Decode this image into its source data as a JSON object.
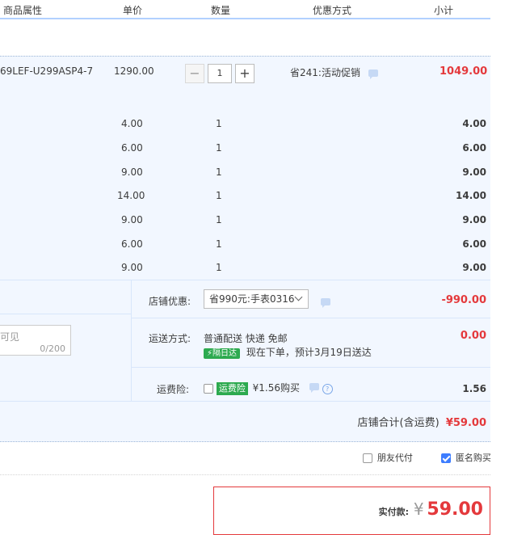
{
  "header": {
    "col_attr": "商品属性",
    "col_price": "单价",
    "col_qty": "数量",
    "col_promo": "优惠方式",
    "col_subtotal": "小计"
  },
  "main_item": {
    "attr": "69LEF-U299ASP4-7",
    "price": "1290.00",
    "qty": "1",
    "minus": "−",
    "plus": "+",
    "promo_text": "省241:活动促销",
    "subtotal": "1049.00"
  },
  "sub_items": [
    {
      "price": "4.00",
      "qty": "1",
      "subtotal": "4.00"
    },
    {
      "price": "6.00",
      "qty": "1",
      "subtotal": "6.00"
    },
    {
      "price": "9.00",
      "qty": "1",
      "subtotal": "9.00"
    },
    {
      "price": "14.00",
      "qty": "1",
      "subtotal": "14.00"
    },
    {
      "price": "9.00",
      "qty": "1",
      "subtotal": "9.00"
    },
    {
      "price": "6.00",
      "qty": "1",
      "subtotal": "6.00"
    },
    {
      "price": "9.00",
      "qty": "1",
      "subtotal": "9.00"
    }
  ],
  "store_coupon": {
    "label": "店铺优惠:",
    "selected": "省990元:手表0316",
    "amount": "-990.00"
  },
  "remark": {
    "placeholder_tail": "可见",
    "counter": "0/200"
  },
  "shipping": {
    "label": "运送方式:",
    "method": "普通配送 快递 免邮",
    "badge": "隔日达",
    "eta": "现在下单，预计3月19日送达",
    "amount": "0.00"
  },
  "insurance": {
    "label": "运费险:",
    "tag": "运费险",
    "desc": "¥1.56购买",
    "amount": "1.56",
    "help": "?"
  },
  "store_total": {
    "label": "店铺合计(含运费)",
    "amount": "¥59.00"
  },
  "options": {
    "friend_pay": "朋友代付",
    "anonymous": "匿名购买"
  },
  "payment": {
    "label": "实付款:",
    "currency": "¥",
    "amount": "59.00"
  },
  "colors": {
    "accent_red": "#e4393c",
    "header_border": "#b2d1ff",
    "block_bg": "#f2f7ff",
    "green": "#2daa4f",
    "checkbox_blue": "#3d7dff"
  }
}
